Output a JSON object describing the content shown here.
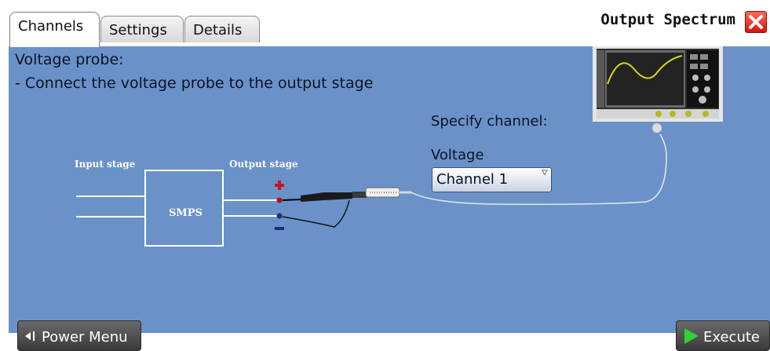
{
  "dialog": {
    "title": "Output Spectrum",
    "tabs": [
      {
        "label": "Channels",
        "active": true
      },
      {
        "label": "Settings",
        "active": false
      },
      {
        "label": "Details",
        "active": false
      }
    ]
  },
  "instructions": {
    "line1": "Voltage probe:",
    "line2": "- Connect the voltage probe to the output stage"
  },
  "diagram": {
    "input_stage_label": "Input stage",
    "output_stage_label": "Output stage",
    "box_label": "SMPS"
  },
  "channel": {
    "specify_label": "Specify channel:",
    "voltage_label": "Voltage",
    "selected": "Channel 1"
  },
  "footer": {
    "power_menu_label": "Power Menu",
    "execute_label": "Execute"
  },
  "colors": {
    "panel_bg": "#6a92c9",
    "close_red": "#e0291f",
    "execute_green": "#32d13c"
  }
}
